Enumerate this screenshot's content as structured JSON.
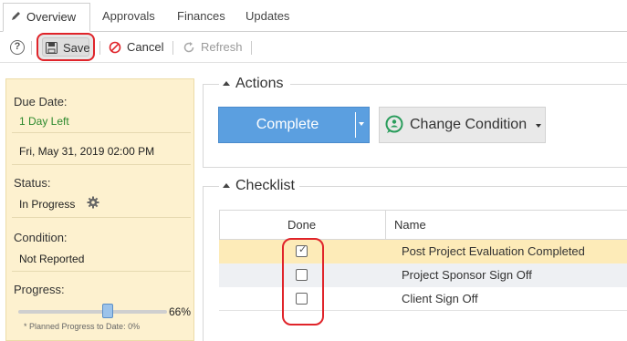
{
  "tabs": [
    {
      "label": "Overview",
      "active": true
    },
    {
      "label": "Approvals"
    },
    {
      "label": "Finances"
    },
    {
      "label": "Updates"
    }
  ],
  "toolbar": {
    "help": "?",
    "save_label": "Save",
    "cancel_label": "Cancel",
    "refresh_label": "Refresh"
  },
  "details": {
    "due_date_label": "Due Date:",
    "due_remaining": "1 Day Left",
    "due_datetime": "Fri, May 31, 2019 02:00 PM",
    "status_label": "Status:",
    "status_value": "In Progress",
    "condition_label": "Condition:",
    "condition_value": "Not Reported",
    "progress_label": "Progress:",
    "progress_value": "66%",
    "progress_fraction": 0.66,
    "planned_note": "* Planned Progress to Date: 0%"
  },
  "actions": {
    "title": "Actions",
    "complete_label": "Complete",
    "change_condition_label": "Change Condition"
  },
  "checklist": {
    "title": "Checklist",
    "columns": [
      "Done",
      "Name"
    ],
    "rows": [
      {
        "name": "Post Project Evaluation Completed",
        "done": true
      },
      {
        "name": "Project Sponsor Sign Off",
        "done": false
      },
      {
        "name": "Client Sign Off",
        "done": false
      }
    ]
  },
  "colors": {
    "accent_blue": "#5b9fe0",
    "highlight_red": "#e0242a",
    "panel_yellow": "#fdf1cf",
    "row_highlight": "#fdebb8",
    "row_alt": "#eef0f3",
    "success_green": "#2d8a2d"
  }
}
